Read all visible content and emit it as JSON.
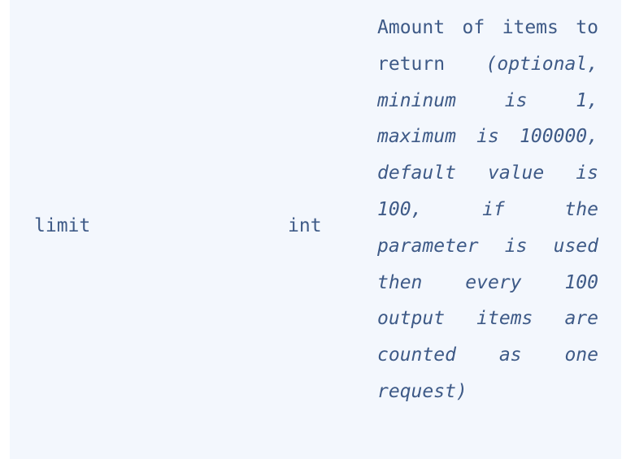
{
  "parameter_row": {
    "name": "limit",
    "type": "int",
    "description": {
      "text": "Amount of items to return",
      "note": "(optional, mininum is 1, maximum is 100000, default value is 100, if the parameter is used then every 100 output items are counted as one request)"
    }
  },
  "colors": {
    "row_background": "#f3f7fd",
    "text": "#3e5a87"
  }
}
